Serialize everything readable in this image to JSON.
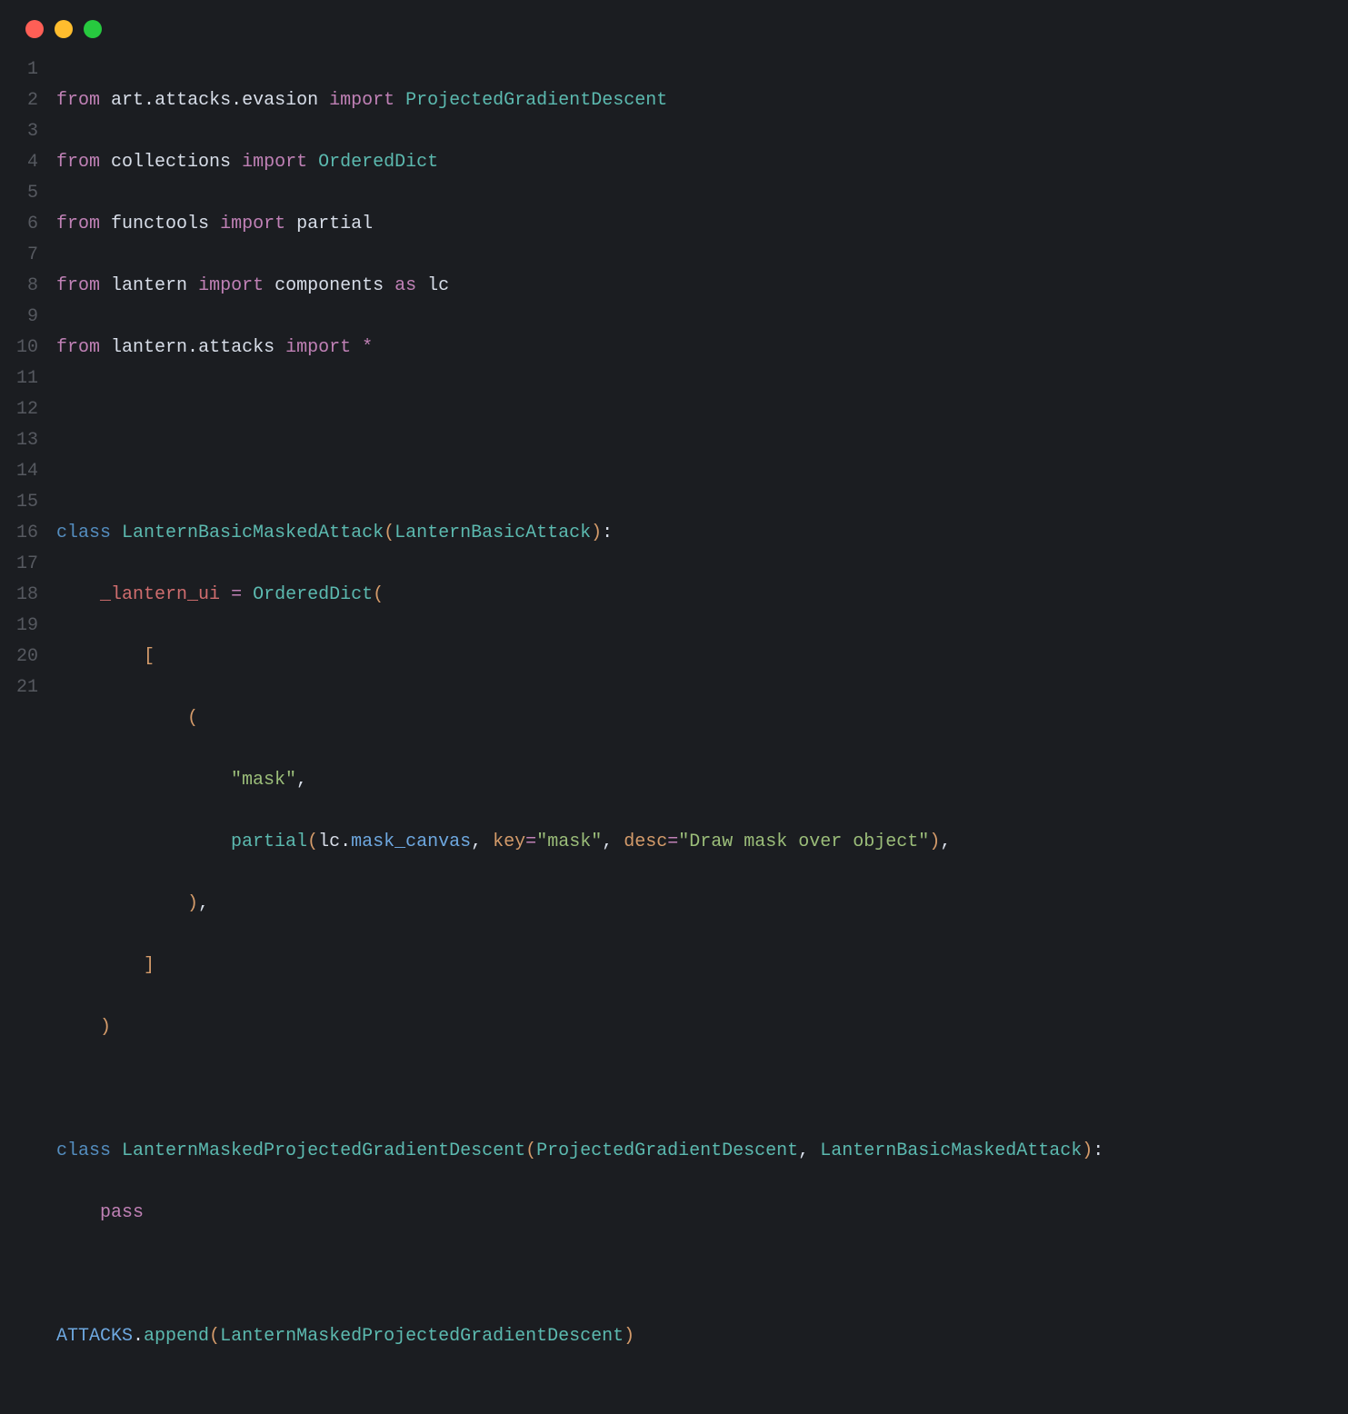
{
  "colors": {
    "bg": "#1b1d21",
    "gutter": "#565960",
    "default": "#d8dee9",
    "keyword_purple": "#c081b6",
    "keyword_blue": "#548dbf",
    "teal": "#5cbab0",
    "blue": "#6ea8e0",
    "red": "#cf6d6e",
    "orange": "#d49b6a",
    "green": "#9bbd79"
  },
  "traffic_lights": {
    "red": "close",
    "yellow": "minimize",
    "green": "maximize"
  },
  "lines": {
    "n1": "1",
    "n2": "2",
    "n3": "3",
    "n4": "4",
    "n5": "5",
    "n6": "6",
    "n7": "7",
    "n8": "8",
    "n9": "9",
    "n10": "10",
    "n11": "11",
    "n12": "12",
    "n13": "13",
    "n14": "14",
    "n15": "15",
    "n16": "16",
    "n17": "17",
    "n18": "18",
    "n19": "19",
    "n20": "20",
    "n21": "21"
  },
  "t": {
    "from": "from",
    "import": "import",
    "class": "class",
    "as": "as",
    "pass": "pass",
    "m_art": "art",
    "m_attacks": "attacks",
    "m_evasion": "evasion",
    "m_collections": "collections",
    "m_functools": "functools",
    "m_lantern": "lantern",
    "c_PGD": "ProjectedGradientDescent",
    "c_OD": "OrderedDict",
    "f_partial": "partial",
    "m_components": "components",
    "alias_lc": "lc",
    "star": "*",
    "c_LBMA": "LanternBasicMaskedAttack",
    "c_LBA": "LanternBasicAttack",
    "a_lui": "_lantern_ui",
    "s_mask": "\"mask\"",
    "a_lc": "lc",
    "a_mc": "mask_canvas",
    "kw_key": "key",
    "kw_desc": "desc",
    "s_key": "\"mask\"",
    "s_desc": "\"Draw mask over object\"",
    "c_LMPGD": "LanternMaskedProjectedGradientDescent",
    "c_ATTACKS": "ATTACKS",
    "f_append": "append",
    "dot": ".",
    "comma": ",",
    "lpar": "(",
    "rpar": ")",
    "lbrk": "[",
    "rbrk": "]",
    "eq": "=",
    "colon": ":"
  },
  "code_plain": "from art.attacks.evasion import ProjectedGradientDescent\nfrom collections import OrderedDict\nfrom functools import partial\nfrom lantern import components as lc\nfrom lantern.attacks import *\n\n\nclass LanternBasicMaskedAttack(LanternBasicAttack):\n    _lantern_ui = OrderedDict(\n        [\n            (\n                \"mask\",\n                partial(lc.mask_canvas, key=\"mask\", desc=\"Draw mask over object\"),\n            ),\n        ]\n    )\n\nclass LanternMaskedProjectedGradientDescent(ProjectedGradientDescent, LanternBasicMaskedAttack):\n    pass\n\nATTACKS.append(LanternMaskedProjectedGradientDescent)"
}
